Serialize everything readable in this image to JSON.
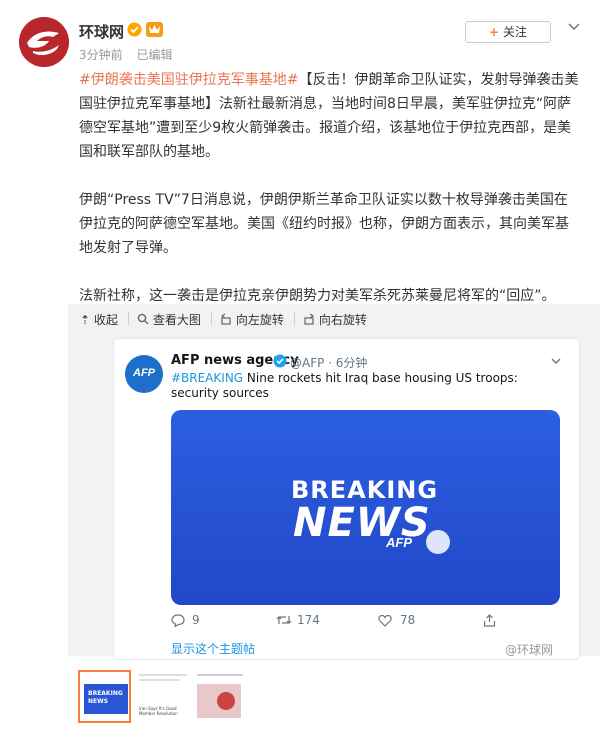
{
  "post": {
    "username": "环球网",
    "time": "3分钟前",
    "edited": "已编辑",
    "follow_label": "关注",
    "topic": "#伊朗袭击美国驻伊拉克军事基地#",
    "para1_rest": "【反击！伊朗革命卫队证实，发射导弹袭击美国驻伊拉克军事基地】法新社最新消息，当地时间8日早晨，美军驻伊拉克“阿萨德空军基地”遭到至少9枚火箭弹袭击。报道介绍，该基地位于伊拉克西部，是美国和联军部队的基地。",
    "para2": "伊朗“Press TV”7日消息说，伊朗伊斯兰革命卫队证实以数十枚导弹袭击美国在伊拉克的阿萨德空军基地。美国《纽约时报》也称，伊朗方面表示，其向美军基地发射了导弹。",
    "para3": "法新社称，这一袭击是伊拉克亲伊朗势力对美军杀死苏莱曼尼将军的“回应”。"
  },
  "toolbar": {
    "collapse": "收起",
    "view_large": "查看大图",
    "rotate_left": "向左旋转",
    "rotate_right": "向右旋转"
  },
  "tweet": {
    "logo_text": "AFP",
    "name": "AFP news agency",
    "handle": "@AFP · 6分钟",
    "hashtag": "#BREAKING",
    "text": " Nine rockets hit Iraq base housing US troops: security sources",
    "card_line1": "BREAKING",
    "card_line2": "NEWS",
    "card_line3": "AFP",
    "replies": "9",
    "retweets": "174",
    "likes": "78",
    "show_thread": "显示这个主题帖"
  },
  "watermark": "@环球网",
  "thumbnails": [
    {
      "label": "BREAKING NEWS",
      "selected": true
    },
    {
      "label": "Iran Says It's Good Member Resolution",
      "selected": false
    },
    {
      "label": "",
      "selected": false
    }
  ],
  "colors": {
    "topic": "#eb7350",
    "link": "#1b95e0",
    "brand": "#b8272c",
    "card_blue": "#2b5fe0",
    "selected_border": "#fa7d3c"
  }
}
